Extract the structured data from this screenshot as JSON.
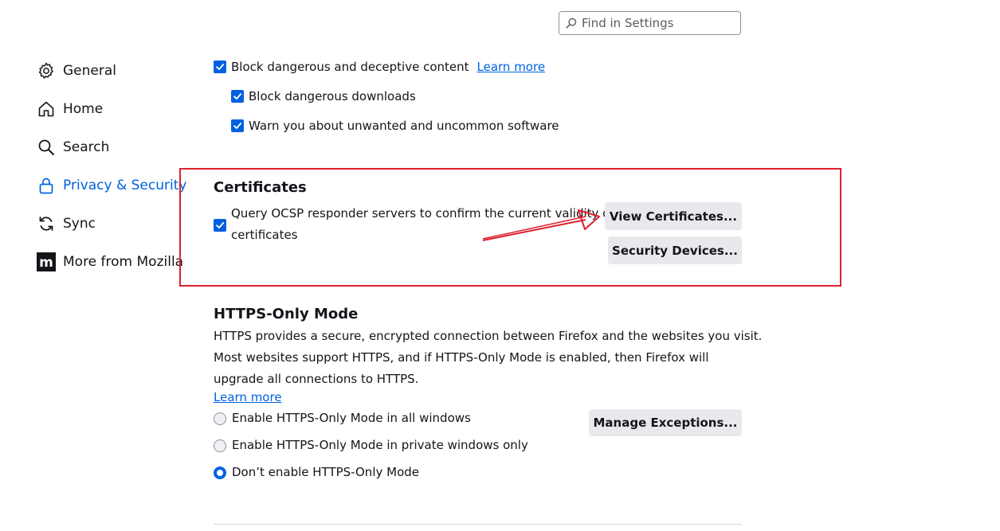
{
  "search": {
    "placeholder": "Find in Settings"
  },
  "sidebar": {
    "items": [
      {
        "label": "General",
        "icon": "gear-icon"
      },
      {
        "label": "Home",
        "icon": "home-icon"
      },
      {
        "label": "Search",
        "icon": "search-icon"
      },
      {
        "label": "Privacy & Security",
        "icon": "lock-icon",
        "selected": true
      },
      {
        "label": "Sync",
        "icon": "sync-icon"
      },
      {
        "label": "More from Mozilla",
        "icon": "mozilla-icon"
      }
    ]
  },
  "deceptive": {
    "block_label": "Block dangerous and deceptive content",
    "learn_more": "Learn more",
    "downloads_label": "Block dangerous downloads",
    "unwanted_label": "Warn you about unwanted and uncommon software",
    "block_checked": true,
    "downloads_checked": true,
    "unwanted_checked": true
  },
  "certificates": {
    "heading": "Certificates",
    "ocsp_label_line1": "Query OCSP responder servers to confirm the current validity of",
    "ocsp_label_line2": "certificates",
    "ocsp_checked": true,
    "view_button": "View Certificates...",
    "devices_button": "Security Devices..."
  },
  "https_only": {
    "heading": "HTTPS-Only Mode",
    "desc_line1": "HTTPS provides a secure, encrypted connection between Firefox and the websites you visit.",
    "desc_line2": "Most websites support HTTPS, and if HTTPS-Only Mode is enabled, then Firefox will",
    "desc_line3": "upgrade all connections to HTTPS.",
    "learn_more": "Learn more",
    "options": [
      {
        "label": "Enable HTTPS-Only Mode in all windows",
        "checked": false
      },
      {
        "label": "Enable HTTPS-Only Mode in private windows only",
        "checked": false
      },
      {
        "label": "Don’t enable HTTPS-Only Mode",
        "checked": true
      }
    ],
    "manage_button": "Manage Exceptions..."
  },
  "colors": {
    "accent": "#0061e0",
    "annotation": "#e0202e",
    "button_bg": "#e9e9ed"
  }
}
